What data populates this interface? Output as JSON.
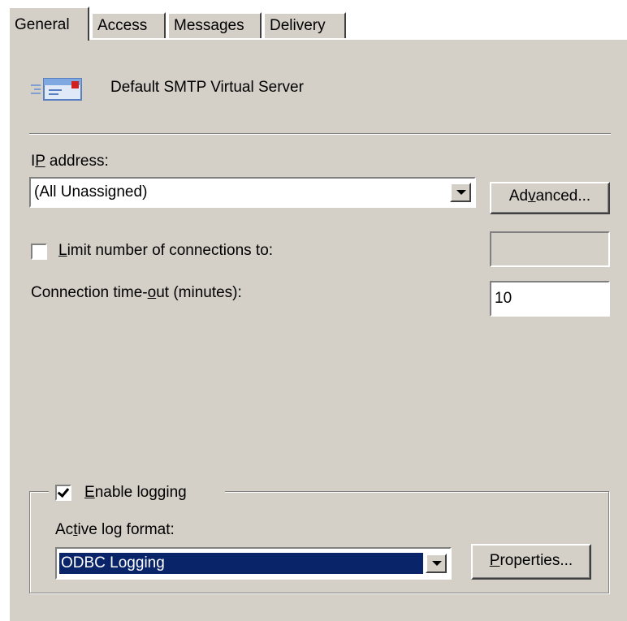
{
  "tabs": [
    {
      "label": "General",
      "active": true
    },
    {
      "label": "Access",
      "active": false
    },
    {
      "label": "Messages",
      "active": false
    },
    {
      "label": "Delivery",
      "active": false
    }
  ],
  "server": {
    "name": "Default SMTP Virtual Server",
    "icon": "smtp-server-icon"
  },
  "ip": {
    "label_pre": "I",
    "label_accel": "P",
    "label_post": " address:",
    "value": "(All Unassigned)",
    "advanced_pre": "Ad",
    "advanced_accel": "v",
    "advanced_post": "anced..."
  },
  "limit": {
    "label_accel": "L",
    "label_post": "imit number of connections to:",
    "checked": false,
    "value": ""
  },
  "timeout": {
    "label_pre": "Connection time-",
    "label_accel": "o",
    "label_post": "ut (minutes):",
    "value": "10"
  },
  "logging": {
    "enable_accel": "E",
    "enable_post": "nable logging",
    "checked": true,
    "format_label_pre": "Ac",
    "format_label_accel": "t",
    "format_label_post": "ive log format:",
    "format_value": "ODBC Logging",
    "properties_pre": "",
    "properties_accel": "P",
    "properties_post": "roperties..."
  },
  "colors": {
    "dialog_bg": "#d4d0c8",
    "selection": "#0a246a"
  }
}
